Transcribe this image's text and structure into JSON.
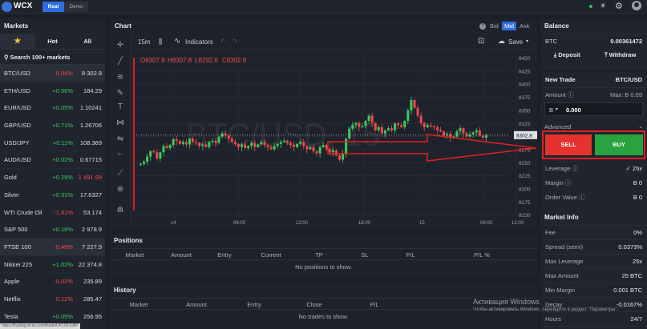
{
  "topbar": {
    "brand": "WCX",
    "real": "Real",
    "demo": "Demo"
  },
  "markets": {
    "title": "Markets",
    "tabs": [
      "★",
      "Hot",
      "All"
    ],
    "search": "Search 100+ markets",
    "items": [
      {
        "name": "BTC/USD",
        "change": "-0.04%",
        "price": "8 302.8",
        "up": false,
        "selected": true
      },
      {
        "name": "ETH/USD",
        "change": "+0.56%",
        "price": "184.29",
        "up": true
      },
      {
        "name": "EUR/USD",
        "change": "+0.05%",
        "price": "1.10241",
        "up": true
      },
      {
        "name": "GBP/USD",
        "change": "+0.71%",
        "price": "1.26706",
        "up": true
      },
      {
        "name": "USD/JPY",
        "change": "+0.11%",
        "price": "108.369",
        "up": true
      },
      {
        "name": "AUD/USD",
        "change": "+0.02%",
        "price": "0.67715",
        "up": true
      },
      {
        "name": "Gold",
        "change": "+0.29%",
        "price": "1 491.99",
        "up": true,
        "price_color": "#ef4a4a"
      },
      {
        "name": "Silver",
        "change": "+0.31%",
        "price": "17.6327",
        "up": true
      },
      {
        "name": "WTI Crude Oil",
        "change": "-1.81%",
        "price": "53.174",
        "up": false
      },
      {
        "name": "S&P 500",
        "change": "+0.18%",
        "price": "2 978.9",
        "up": true
      },
      {
        "name": "FTSE 100",
        "change": "-0.49%",
        "price": "7 227.9",
        "up": false,
        "selected": true
      },
      {
        "name": "Nikkei 225",
        "change": "+1.02%",
        "price": "22 374.8",
        "up": true
      },
      {
        "name": "Apple",
        "change": "-0.02%",
        "price": "235.89",
        "up": false
      },
      {
        "name": "Netflix",
        "change": "-0.12%",
        "price": "285.47",
        "up": false
      },
      {
        "name": "Tesla",
        "change": "+0.05%",
        "price": "256.95",
        "up": true
      }
    ],
    "status_url": "https://trading.wcex.com/trade/UK100-GBP"
  },
  "chart": {
    "title": "Chart",
    "interval": "15m",
    "indicators": "Indicators",
    "bid": "Bid",
    "mid": "Mid",
    "ask": "Ask",
    "save": "Save",
    "ohlc": {
      "o": "O8307.8",
      "h": "H8307.8",
      "l": "L8292.6",
      "c": "C8302.8"
    },
    "watermark": "BTC/USD, 15",
    "last_price": "8302.8"
  },
  "chart_data": {
    "type": "candlestick",
    "symbol": "BTC/USD",
    "interval": "15m",
    "y_ticks": [
      8450,
      8425,
      8400,
      8375,
      8350,
      8325,
      8300,
      8275,
      8250,
      8225,
      8200,
      8175,
      8150
    ],
    "x_ticks": [
      "14",
      "06:00",
      "12:00",
      "18:00",
      "15",
      "06:00",
      "12:00"
    ],
    "close": [
      8248,
      8252,
      8262,
      8272,
      8270,
      8258,
      8270,
      8282,
      8278,
      8284,
      8295,
      8292,
      8286,
      8290,
      8285,
      8296,
      8290,
      8288,
      8282,
      8285,
      8280,
      8290,
      8292,
      8288,
      8300,
      8306,
      8302,
      8296,
      8290,
      8286,
      8280,
      8285,
      8278,
      8282,
      8288,
      8280,
      8285,
      8290,
      8284,
      8280,
      8276,
      8282,
      8286,
      8290,
      8292,
      8288,
      8284,
      8280,
      8286,
      8290,
      8282,
      8276,
      8280,
      8272,
      8268,
      8280,
      8284,
      8276,
      8270,
      8274,
      8264,
      8256,
      8268,
      8296,
      8315,
      8322,
      8326,
      8318,
      8320,
      8330,
      8340,
      8326,
      8312,
      8318,
      8306,
      8312,
      8316,
      8312,
      8325,
      8322,
      8318,
      8330,
      8350,
      8370,
      8355,
      8340,
      8326,
      8318,
      8322,
      8320,
      8318,
      8313,
      8310,
      8302,
      8305,
      8298,
      8300,
      8310,
      8316,
      8306,
      8300,
      8304,
      8308,
      8312,
      8302,
      8298,
      8302
    ],
    "current": 8302.8,
    "ylim": [
      8145,
      8460
    ]
  },
  "positions": {
    "title": "Positions",
    "cols": [
      "Market",
      "Amount",
      "Entry",
      "Current",
      "TP",
      "SL",
      "P/L",
      "P/L %"
    ],
    "empty": "No positions to show."
  },
  "history": {
    "title": "History",
    "cols": [
      "Market",
      "Amount",
      "Entry",
      "Close",
      "P/L"
    ],
    "empty": "No trades to show."
  },
  "balance": {
    "title": "Balance",
    "asset": "BTC",
    "value": "0.00361472",
    "deposit": "Deposit",
    "withdraw": "Withdraw"
  },
  "trade": {
    "title": "New Trade",
    "pair": "BTC/USD",
    "amount_label": "Amount",
    "max": "Max: B 0.09",
    "currency": "B",
    "amount": "0.000",
    "advanced": "Advanced",
    "sell": "SELL",
    "buy": "BUY",
    "leverage_label": "Leverage",
    "leverage": "25x",
    "margin_label": "Margin",
    "margin": "B 0",
    "order_label": "Order Value",
    "order": "B 0"
  },
  "info": {
    "title": "Market Info",
    "rows": [
      [
        "Fee",
        "0%"
      ],
      [
        "Spread (semi)",
        "0.0373%"
      ],
      [
        "Max Leverage",
        "25x"
      ],
      [
        "Max Amount",
        "25 BTC"
      ],
      [
        "Min Margin",
        "0.001 BTC"
      ],
      [
        "Decay",
        "-0.0167%"
      ],
      [
        "Hours",
        "24/7"
      ]
    ]
  },
  "windows": {
    "line1": "Активация Windows",
    "line2": "Чтобы активировать Windows, перейдите в раздел \"Параметры\"."
  },
  "colors": {
    "up": "#3ec95c",
    "down": "#ef4a4a",
    "accent": "#2f6de0"
  }
}
